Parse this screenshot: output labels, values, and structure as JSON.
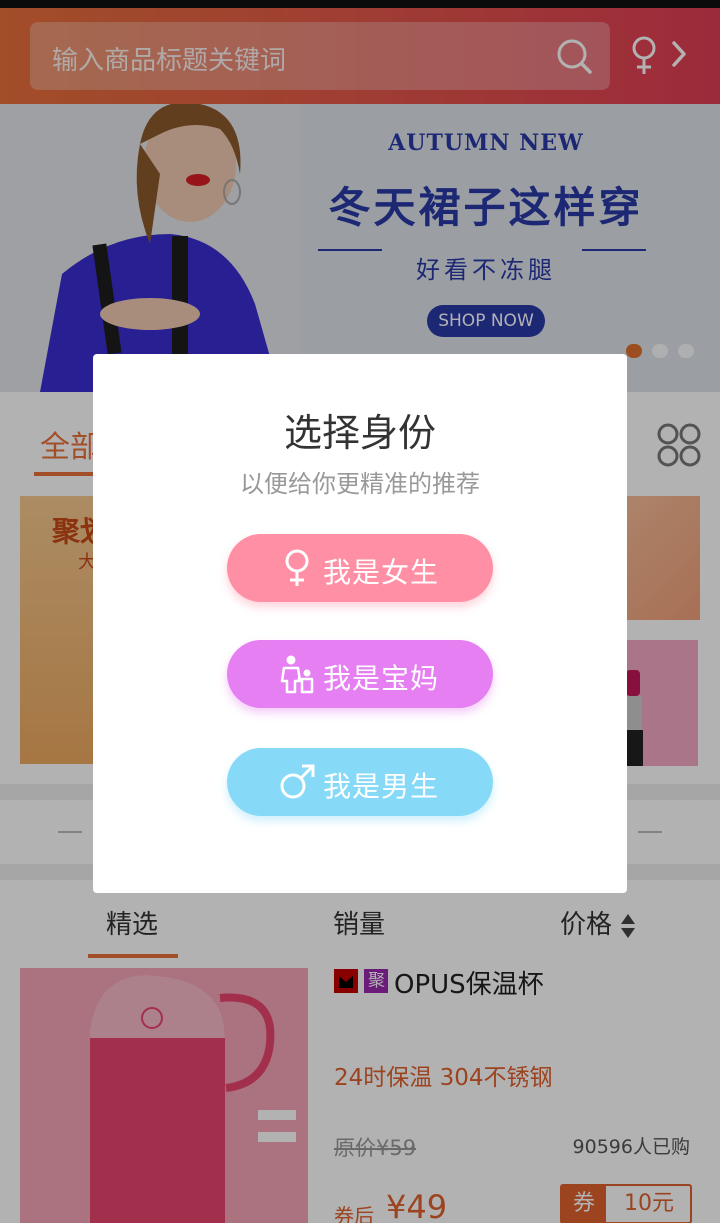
{
  "header": {
    "search_placeholder": "输入商品标题关键词"
  },
  "banner": {
    "sub_title": "AUTUMN NEW",
    "headline": "冬天裙子这样穿",
    "tagline": "好看不冻腿",
    "cta": "SHOP NOW",
    "slide_count": 3,
    "active_slide": 1
  },
  "categories": {
    "active": "全部"
  },
  "promo": {
    "left_title": "聚划",
    "left_sub": "大"
  },
  "sort_tabs": [
    {
      "label": "精选",
      "active": true
    },
    {
      "label": "销量",
      "active": false
    },
    {
      "label": "价格",
      "active": false
    }
  ],
  "product": {
    "badges": [
      "天猫",
      "聚"
    ],
    "name": "OPUS保温杯",
    "desc": "24时保温 304不锈钢",
    "orig_price": "原价¥59",
    "sold": "90596人已购",
    "after_label": "券后",
    "price": "¥49",
    "coupon_tag": "券",
    "coupon_amount": "10元"
  },
  "modal": {
    "title": "选择身份",
    "subtitle": "以便给你更精准的推荐",
    "buttons": {
      "female": "我是女生",
      "mom": "我是宝妈",
      "male": "我是男生"
    }
  },
  "colors": {
    "accent": "#e8703a",
    "header_start": "#e8703a",
    "header_end": "#e03d55",
    "female_button": "#ff8fa4",
    "mom_button": "#e67ff2",
    "male_button": "#86d9f7",
    "banner_text": "#2a3aa8"
  },
  "icons": {
    "search": "search-icon",
    "gender_switch": "female-icon",
    "grid": "category-grid-icon",
    "female": "female-icon",
    "mom": "mother-child-icon",
    "male": "male-icon",
    "sort": "sort-arrows-icon"
  }
}
